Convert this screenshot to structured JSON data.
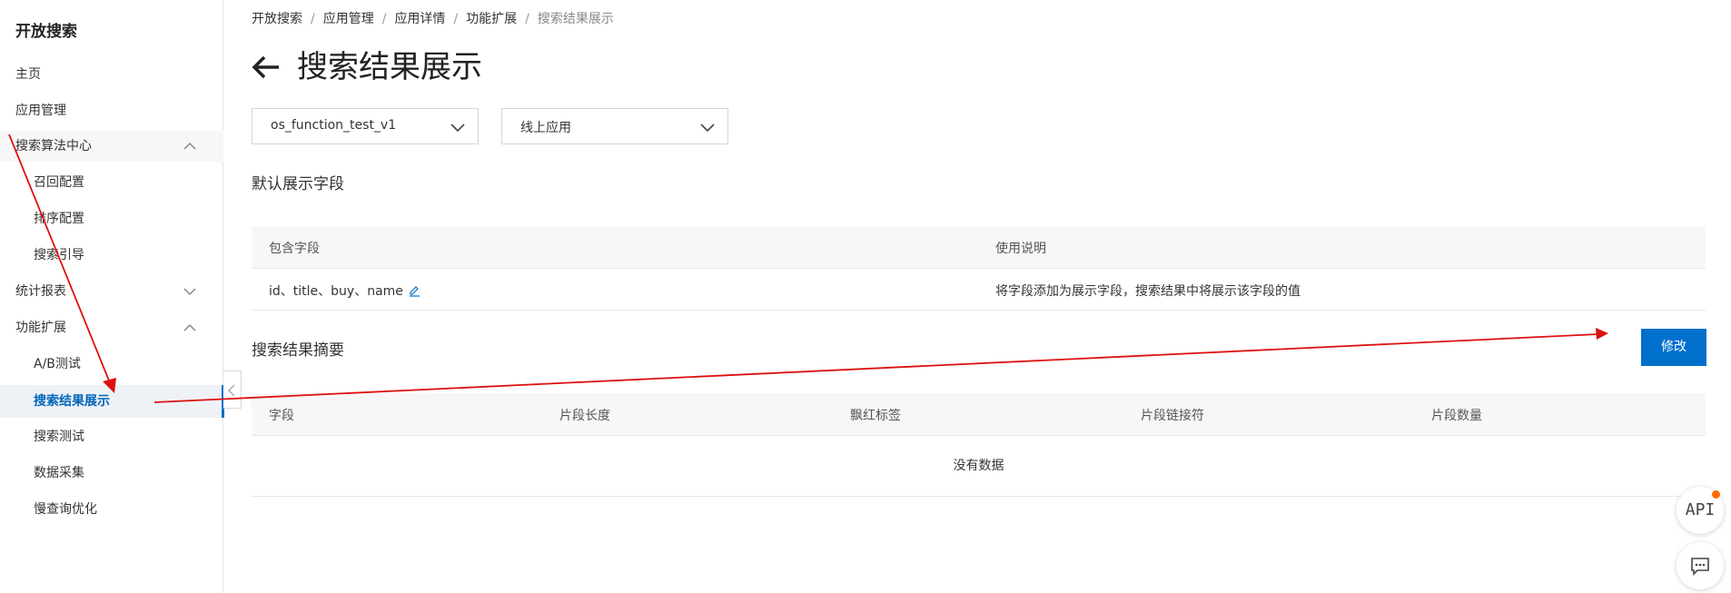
{
  "sidebar": {
    "brand": "开放搜索",
    "items": [
      {
        "label": "主页"
      },
      {
        "label": "应用管理"
      },
      {
        "label": "搜索算法中心"
      },
      {
        "label": "召回配置"
      },
      {
        "label": "排序配置"
      },
      {
        "label": "搜索引导"
      },
      {
        "label": "统计报表"
      },
      {
        "label": "功能扩展"
      },
      {
        "label": "A/B测试"
      },
      {
        "label": "搜索结果展示"
      },
      {
        "label": "搜索测试"
      },
      {
        "label": "数据采集"
      },
      {
        "label": "慢查询优化"
      }
    ]
  },
  "breadcrumb": [
    "开放搜索",
    "应用管理",
    "应用详情",
    "功能扩展",
    "搜索结果展示"
  ],
  "page": {
    "title": "搜索结果展示"
  },
  "selects": {
    "app": "os_function_test_v1",
    "version": "线上应用"
  },
  "default_fields": {
    "title": "默认展示字段",
    "headers": [
      "包含字段",
      "使用说明"
    ],
    "row": {
      "fields": "id、title、buy、name",
      "desc": "将字段添加为展示字段，搜索结果中将展示该字段的值"
    }
  },
  "summary": {
    "title": "搜索结果摘要",
    "edit_label": "修改",
    "headers": [
      "字段",
      "片段长度",
      "飘红标签",
      "片段链接符",
      "片段数量"
    ],
    "empty": "没有数据"
  },
  "fab": {
    "api_label": "API"
  },
  "colors": {
    "primary": "#0070cc",
    "annotation": "#dd1111",
    "badge": "#ff6a00"
  },
  "icons": [
    "back-arrow-icon",
    "chevron-down-icon",
    "chevron-up-icon",
    "edit-pencil-icon",
    "chevron-left-icon",
    "chat-icon"
  ]
}
